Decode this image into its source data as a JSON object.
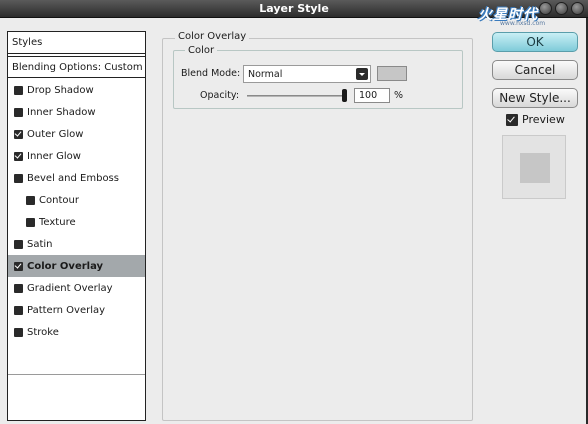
{
  "window": {
    "title": "Layer Style"
  },
  "watermark": {
    "main": "火星时代",
    "sub": "www.hxsd.com"
  },
  "sidebar": {
    "header_styles": "Styles",
    "header_blending": "Blending Options: Custom",
    "items": [
      {
        "label": "Drop Shadow",
        "checked": false,
        "sub": false,
        "active": false
      },
      {
        "label": "Inner Shadow",
        "checked": false,
        "sub": false,
        "active": false
      },
      {
        "label": "Outer Glow",
        "checked": true,
        "sub": false,
        "active": false
      },
      {
        "label": "Inner Glow",
        "checked": true,
        "sub": false,
        "active": false
      },
      {
        "label": "Bevel and Emboss",
        "checked": false,
        "sub": false,
        "active": false
      },
      {
        "label": "Contour",
        "checked": false,
        "sub": true,
        "active": false
      },
      {
        "label": "Texture",
        "checked": false,
        "sub": true,
        "active": false
      },
      {
        "label": "Satin",
        "checked": false,
        "sub": false,
        "active": false
      },
      {
        "label": "Color Overlay",
        "checked": true,
        "sub": false,
        "active": true
      },
      {
        "label": "Gradient Overlay",
        "checked": false,
        "sub": false,
        "active": false
      },
      {
        "label": "Pattern Overlay",
        "checked": false,
        "sub": false,
        "active": false
      },
      {
        "label": "Stroke",
        "checked": false,
        "sub": false,
        "active": false
      }
    ]
  },
  "panel": {
    "group_title": "Color Overlay",
    "subgroup_title": "Color",
    "blend_mode_label": "Blend Mode:",
    "blend_mode_value": "Normal",
    "overlay_color": "#c6c6c6",
    "opacity_label": "Opacity:",
    "opacity_value": "100",
    "opacity_unit": "%",
    "opacity_level": 1.0
  },
  "buttons": {
    "ok": "OK",
    "cancel": "Cancel",
    "new_style": "New Style...",
    "preview_label": "Preview",
    "preview_checked": true
  }
}
